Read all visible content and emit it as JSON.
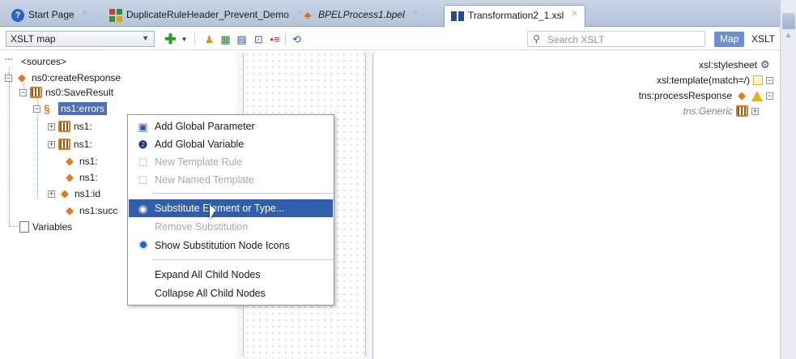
{
  "tabs": [
    {
      "label": "Start Page",
      "icon": "help-icon",
      "italic": false,
      "active": false
    },
    {
      "label": "DuplicateRuleHeader_Prevent_Demo",
      "icon": "grid-icon",
      "italic": false,
      "active": false
    },
    {
      "label": "BPELProcess1.bpel",
      "icon": "bpel-icon",
      "italic": true,
      "active": false
    },
    {
      "label": "Transformation2_1.xsl",
      "icon": "xsl-icon",
      "italic": false,
      "active": true
    }
  ],
  "toolbar": {
    "mode_select": "XSLT map",
    "search_placeholder": "Search XSLT",
    "map_label": "Map",
    "xslt_label": "XSLT"
  },
  "source_tree": {
    "root": "<sources>",
    "items": [
      {
        "label": "ns0:createResponse"
      },
      {
        "label": "ns0:SaveResult"
      },
      {
        "label": "ns1:errors"
      },
      {
        "label": "ns1:"
      },
      {
        "label": "ns1:"
      },
      {
        "label": "ns1:"
      },
      {
        "label": "ns1:"
      },
      {
        "label": "ns1:id"
      },
      {
        "label": "ns1:succ"
      }
    ],
    "variables": "Variables"
  },
  "target_tree": [
    {
      "label": "xsl:stylesheet"
    },
    {
      "label": "xsl:template(match=/)"
    },
    {
      "label": "tns:processResponse"
    },
    {
      "label": "tns:Generic"
    }
  ],
  "context_menu": [
    {
      "label": "Add Global Parameter",
      "disabled": false,
      "icon": "global-parameter-icon"
    },
    {
      "label": "Add Global Variable",
      "disabled": false,
      "icon": "global-variable-icon"
    },
    {
      "label": "New Template Rule",
      "disabled": true,
      "icon": "template-rule-icon"
    },
    {
      "label": "New Named Template",
      "disabled": true,
      "icon": "named-template-icon"
    },
    {
      "label": "Substitute Element or Type...",
      "disabled": false,
      "highlighted": true,
      "icon": "substitute-icon"
    },
    {
      "label": "Remove Substitution",
      "disabled": true,
      "icon": ""
    },
    {
      "label": "Show Substitution Node Icons",
      "disabled": false,
      "checked": true,
      "icon": "radio-checked-icon"
    },
    {
      "label": "Expand All Child Nodes",
      "disabled": false,
      "icon": ""
    },
    {
      "label": "Collapse All Child Nodes",
      "disabled": false,
      "icon": ""
    }
  ],
  "colors": {
    "selection": "#2f5fac",
    "node_orange": "#e07a1e",
    "map_toggle": "#6b8fd0"
  }
}
